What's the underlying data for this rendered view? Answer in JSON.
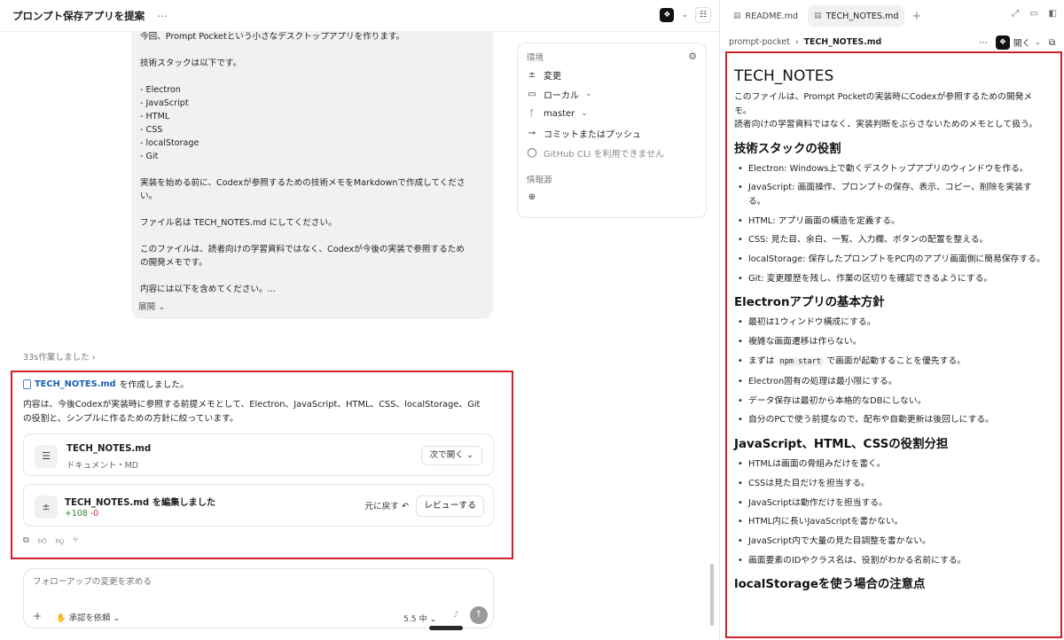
{
  "left": {
    "title": "プロンプト保存アプリを提案",
    "more_icon": "⋯",
    "header_icons": {
      "brand": "❖",
      "chevron": "⌄",
      "panel": "☷"
    }
  },
  "message": {
    "lines": [
      "今回、Prompt Pocketという小さなデスクトップアプリを作ります。",
      "",
      "技術スタックは以下です。",
      "",
      "- Electron",
      "- JavaScript",
      "- HTML",
      "- CSS",
      "- localStorage",
      "- Git",
      "",
      "実装を始める前に、Codexが参照するための技術メモをMarkdownで作成してくださ",
      "い。",
      "",
      "ファイル名は TECH_NOTES.md にしてください。",
      "",
      "このファイルは、読者向けの学習資料ではなく、Codexが今後の実装で参照するため",
      "の開発メモです。",
      "",
      "内容には以下を含めてください。..."
    ],
    "expand_label": "展開"
  },
  "environment": {
    "label": "環境",
    "items": [
      {
        "icon": "±",
        "label": "変更",
        "chevron": ""
      },
      {
        "icon": "▭",
        "label": "ローカル",
        "chevron": "⌄"
      },
      {
        "icon": "ᚴ",
        "label": "master",
        "chevron": "⌄"
      },
      {
        "icon": "⊸",
        "label": "コミットまたはプッシュ",
        "chevron": ""
      },
      {
        "icon": "◯",
        "label": "GitHub CLI を利用できません",
        "chevron": ""
      }
    ],
    "sources_label": "情報源",
    "globe_icon": "⊕"
  },
  "worked": "33s作業しました",
  "response": {
    "file_link": "TECH_NOTES.md",
    "created_suffix": "を作成しました。",
    "description": "内容は、今後Codexが実装時に参照する前提メモとして、Electron、JavaScript、HTML、CSS、localStorage、Gitの役割と、シンプルに作るための方針に絞っています。",
    "card1": {
      "title": "TECH_NOTES.md",
      "subtitle": "ドキュメント・MD",
      "button": "次で開く ⌄"
    },
    "card2": {
      "title": "TECH_NOTES.md を編集しました",
      "added": "+108",
      "removed": "-0",
      "revert": "元に戻す ↶",
      "review": "レビューする"
    }
  },
  "composer": {
    "placeholder": "フォローアップの変更を求める",
    "plus": "+",
    "approve": "承認を依頼 ⌄",
    "model": "5.5 中 ⌄",
    "mic": "♪",
    "send": "↑"
  },
  "right": {
    "tabs": [
      {
        "label": "README.md",
        "active": false
      },
      {
        "label": "TECH_NOTES.md",
        "active": true
      }
    ],
    "path": {
      "folder": "prompt-pocket",
      "sep": "›",
      "file": "TECH_NOTES.md"
    },
    "open_label": "開く",
    "doc": {
      "title": "TECH_NOTES",
      "intro1": "このファイルは、Prompt Pocketの実装時にCodexが参照するための開発メモ。",
      "intro2": "読者向けの学習資料ではなく、実装判断をぶらさないためのメモとして扱う。",
      "sections": [
        {
          "heading": "技術スタックの役割",
          "items": [
            "Electron: Windows上で動くデスクトップアプリのウィンドウを作る。",
            "JavaScript: 画面操作、プロンプトの保存、表示、コピー、削除を実装する。",
            "HTML: アプリ画面の構造を定義する。",
            "CSS: 見た目、余白、一覧、入力欄、ボタンの配置を整える。",
            "localStorage: 保存したプロンプトをPC内のアプリ画面側に簡易保存する。",
            "Git: 変更履歴を残し、作業の区切りを確認できるようにする。"
          ]
        },
        {
          "heading": "Electronアプリの基本方針",
          "items": [
            "最初は1ウィンドウ構成にする。",
            "複雑な画面遷移は作らない。",
            "@@npm",
            "Electron固有の処理は最小限にする。",
            "データ保存は最初から本格的なDBにしない。",
            "自分のPCで使う前提なので、配布や自動更新は後回しにする。"
          ]
        },
        {
          "heading": "JavaScript、HTML、CSSの役割分担",
          "items": [
            "HTMLは画面の骨組みだけを書く。",
            "CSSは見た目だけを担当する。",
            "JavaScriptは動作だけを担当する。",
            "HTML内に長いJavaScriptを書かない。",
            "JavaScript内で大量の見た目調整を書かない。",
            "画面要素のIDやクラス名は、役割がわかる名前にする。"
          ]
        },
        {
          "heading": "localStorageを使う場合の注意点",
          "items": []
        }
      ],
      "npm_prefix": "まずは",
      "npm_code": "npm start",
      "npm_suffix": "で画面が起動することを優先する。"
    }
  }
}
